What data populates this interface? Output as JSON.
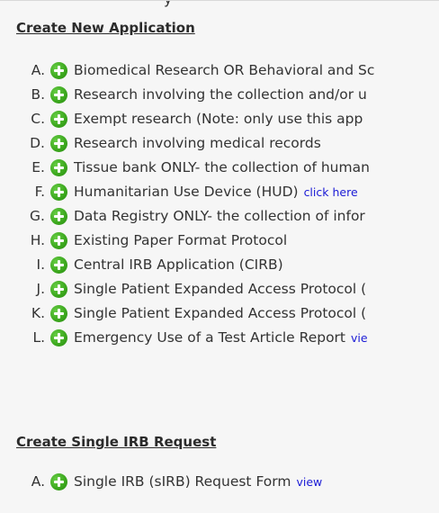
{
  "create_new": {
    "title": "Create New Application",
    "items": [
      {
        "letter": "A.",
        "text": "Biomedical Research OR Behavioral and Sc"
      },
      {
        "letter": "B.",
        "text": "Research involving the collection and/or u"
      },
      {
        "letter": "C.",
        "text": "Exempt research (Note: only use this app"
      },
      {
        "letter": "D.",
        "text": "Research involving medical records"
      },
      {
        "letter": "E.",
        "text": "Tissue bank ONLY- the collection of human"
      },
      {
        "letter": "F.",
        "text": "Humanitarian Use Device (HUD)",
        "link": "click here"
      },
      {
        "letter": "G.",
        "text": "Data Registry ONLY- the collection of infor"
      },
      {
        "letter": "H.",
        "text": "Existing Paper Format Protocol"
      },
      {
        "letter": "I.",
        "text": "Central IRB Application (CIRB)"
      },
      {
        "letter": "J.",
        "text": "Single Patient Expanded Access Protocol ("
      },
      {
        "letter": "K.",
        "text": "Single Patient Expanded Access Protocol ("
      },
      {
        "letter": "L.",
        "text": "Emergency Use of a Test Article Report",
        "link": "vie"
      }
    ]
  },
  "create_single": {
    "title": "Create Single IRB Request",
    "items": [
      {
        "letter": "A.",
        "text": "Single IRB (sIRB) Request Form",
        "link": "view"
      }
    ]
  },
  "top_cut_text": "y",
  "colors": {
    "link": "#1a1ad6",
    "icon_green": "#3aa61c",
    "panel_bg": "#f6f6f6"
  }
}
